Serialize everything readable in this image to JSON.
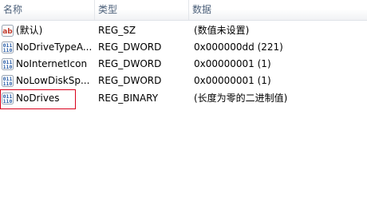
{
  "columns": {
    "name": "名称",
    "type": "类型",
    "data": "数据"
  },
  "rows": [
    {
      "name": "(默认)",
      "type": "REG_SZ",
      "data": "(数值未设置)",
      "icon": "string-value-icon"
    },
    {
      "name": "NoDriveTypeA...",
      "type": "REG_DWORD",
      "data": "0x000000dd (221)",
      "icon": "binary-value-icon"
    },
    {
      "name": "NoInternetIcon",
      "type": "REG_DWORD",
      "data": "0x00000001 (1)",
      "icon": "binary-value-icon"
    },
    {
      "name": "NoLowDiskSp...",
      "type": "REG_DWORD",
      "data": "0x00000001 (1)",
      "icon": "binary-value-icon"
    },
    {
      "name": "NoDrives",
      "type": "REG_BINARY",
      "data": "(长度为零的二进制值)",
      "icon": "binary-value-icon"
    }
  ],
  "colors": {
    "highlight_border": "#d9001b",
    "header_text": "#4c607a",
    "string_icon_red": "#c0392b",
    "binary_icon_blue": "#2b5fa8"
  }
}
